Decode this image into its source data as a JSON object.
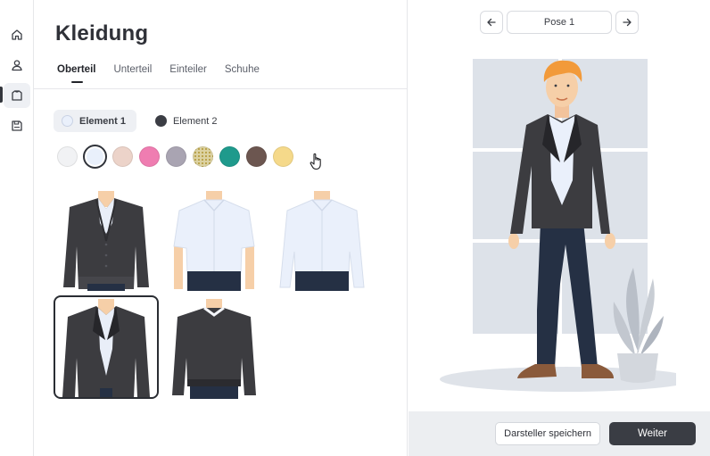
{
  "page": {
    "title": "Kleidung"
  },
  "sidebar": {
    "items": [
      {
        "icon": "home-icon"
      },
      {
        "icon": "user-icon"
      },
      {
        "icon": "shirt-icon",
        "active": true
      },
      {
        "icon": "save-icon"
      }
    ]
  },
  "tabs": [
    {
      "label": "Oberteil",
      "active": true
    },
    {
      "label": "Unterteil"
    },
    {
      "label": "Einteiler"
    },
    {
      "label": "Schuhe"
    }
  ],
  "elements": [
    {
      "label": "Element 1",
      "color": "#eaf0fb",
      "active": true
    },
    {
      "label": "Element 2",
      "color": "#3b3d44"
    }
  ],
  "swatches": [
    {
      "color": "#f1f2f4"
    },
    {
      "color": "#e9f0fb",
      "selected": true
    },
    {
      "color": "#ecd3c9"
    },
    {
      "color": "#ef7db1"
    },
    {
      "color": "#a9a4b2"
    },
    {
      "color": "#dcd2a2",
      "pattern": "dots"
    },
    {
      "color": "#1f9a8c"
    },
    {
      "color": "#6c5650"
    },
    {
      "color": "#f5d98a",
      "hovered": true
    }
  ],
  "garments": [
    {
      "name": "cardigan-dark"
    },
    {
      "name": "shirt-short-sleeve-light"
    },
    {
      "name": "shirt-long-sleeve-light"
    },
    {
      "name": "blazer-dark",
      "selected": true
    },
    {
      "name": "sweater-dark"
    }
  ],
  "preview": {
    "pose_label": "Pose 1",
    "prev_icon": "arrow-left-icon",
    "next_icon": "arrow-right-icon"
  },
  "footer": {
    "save_label": "Darsteller speichern",
    "next_label": "Weiter"
  },
  "colors": {
    "accent": "#3a3d44",
    "jacket": "#3c3c40",
    "shirt": "#eaf0fb",
    "pants": "#253044",
    "skin": "#f6cfa8",
    "hair": "#f29a3a",
    "shoes": "#8a5a3b"
  }
}
